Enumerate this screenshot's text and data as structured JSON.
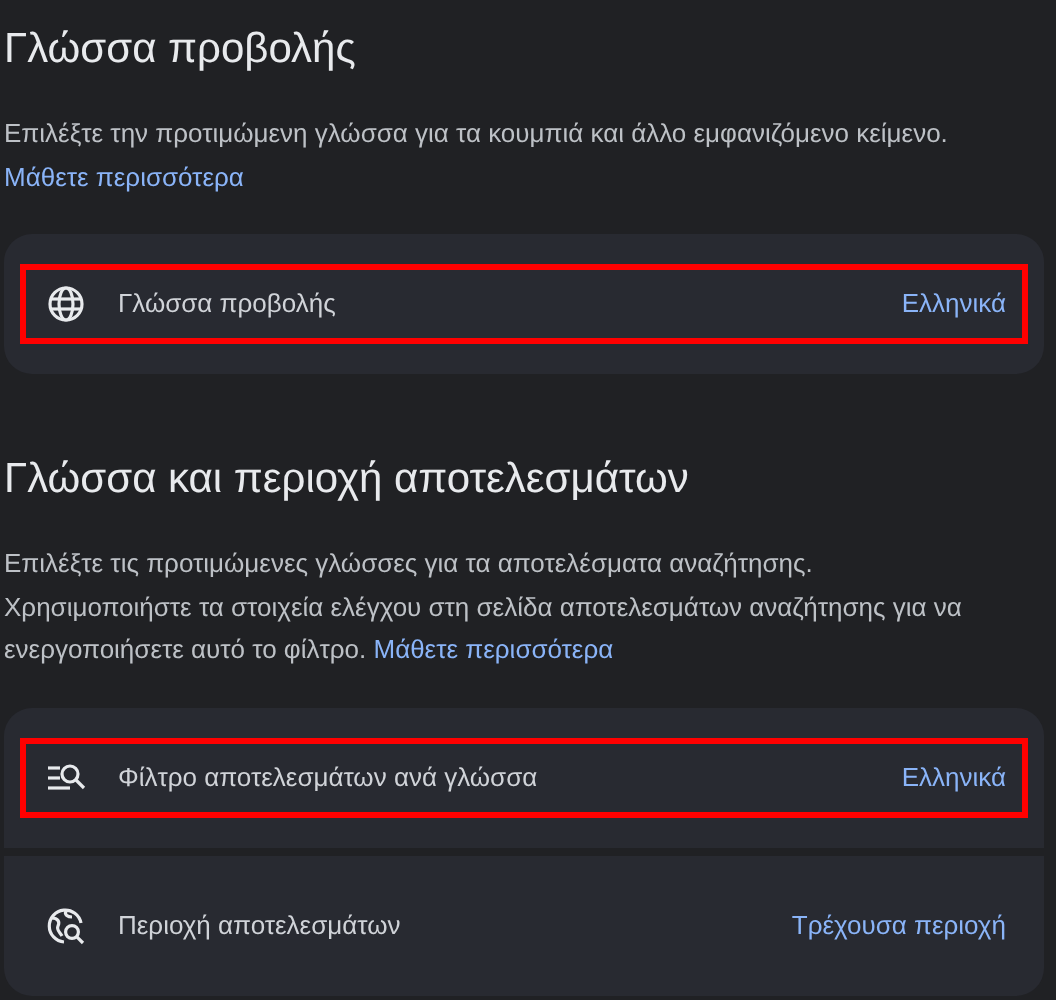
{
  "sections": [
    {
      "title": "Γλώσσα προβολής",
      "description": [
        "Επιλέξτε την προτιμώμενη γλώσσα για τα κουμπιά και άλλο εμφανιζόμενο κείμενο."
      ],
      "link": "Μάθετε περισσότερα",
      "link_inline": false,
      "rows": [
        {
          "kind": "globe",
          "label": "Γλώσσα προβολής",
          "value": "Ελληνικά",
          "highlighted": true
        }
      ]
    },
    {
      "title": "Γλώσσα και περιοχή αποτελεσμάτων",
      "description": [
        "Επιλέξτε τις προτιμώμενες γλώσσες για τα αποτελέσματα αναζήτησης.",
        "Χρησιμοποιήστε τα στοιχεία ελέγχου στη σελίδα αποτελεσμάτων αναζήτησης για να ενεργοποιήσετε αυτό το φίλτρο."
      ],
      "link": "Μάθετε περισσότερα",
      "link_inline": true,
      "rows": [
        {
          "kind": "filter",
          "label": "Φίλτρο αποτελεσμάτων ανά γλώσσα",
          "value": "Ελληνικά",
          "highlighted": true
        },
        {
          "kind": "region",
          "label": "Περιοχή αποτελεσμάτων",
          "value": "Τρέχουσα περιοχή",
          "highlighted": false
        }
      ]
    }
  ]
}
